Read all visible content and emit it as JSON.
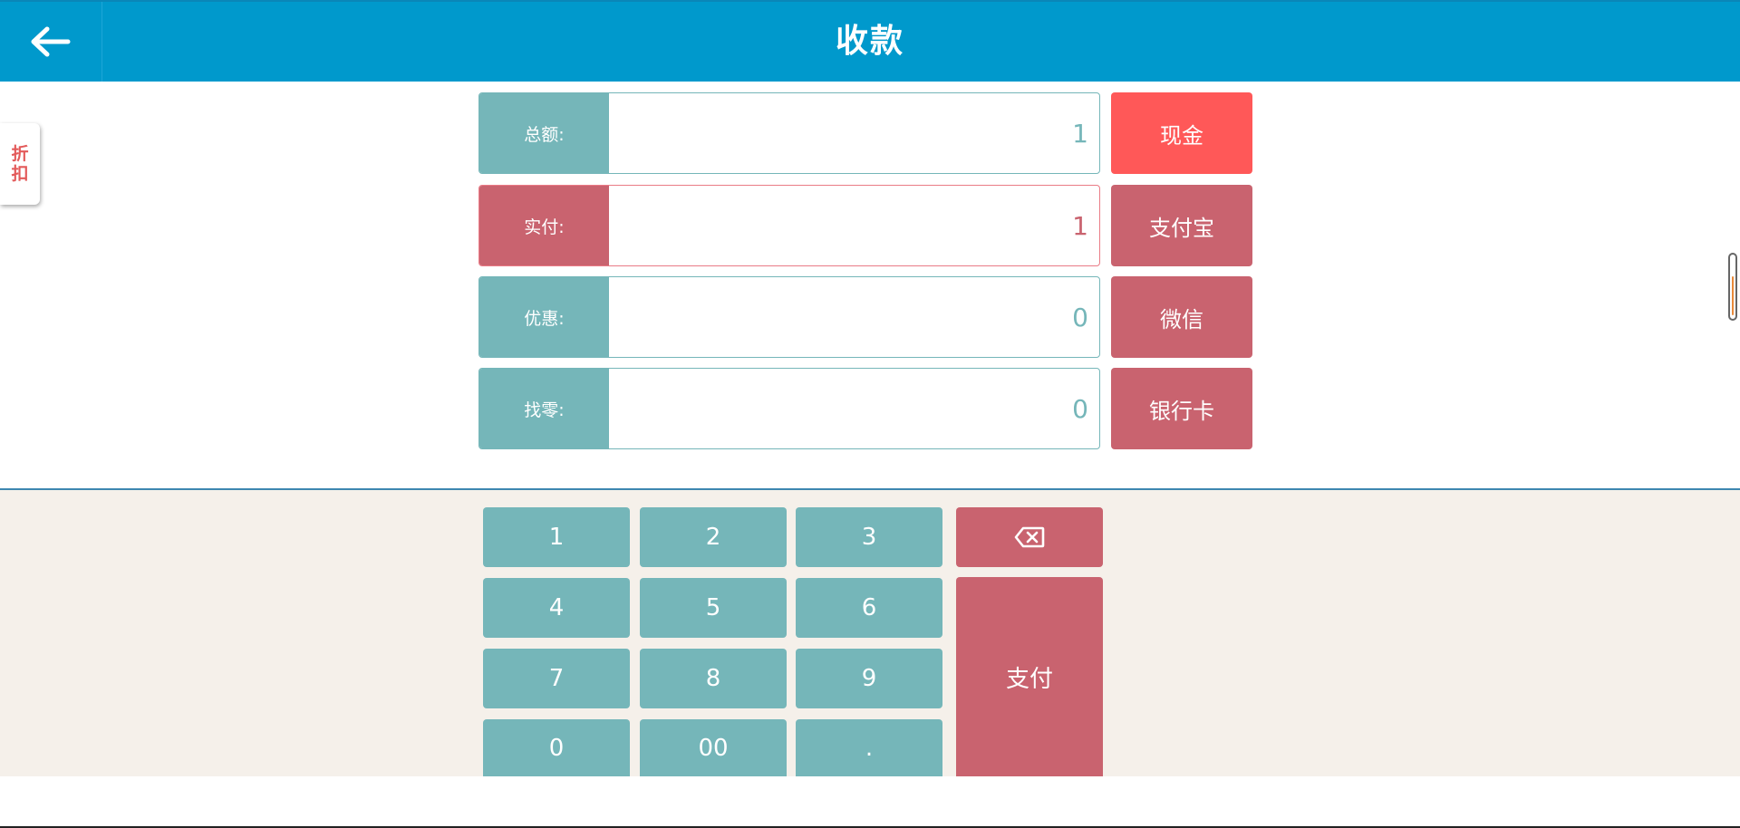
{
  "header": {
    "title": "收款",
    "back_icon": "arrow-left-icon"
  },
  "discount_tab": {
    "line1": "折",
    "line2": "扣"
  },
  "fields": [
    {
      "label": "总额:",
      "value": "1"
    },
    {
      "label": "实付:",
      "value": "1"
    },
    {
      "label": "优惠:",
      "value": "0"
    },
    {
      "label": "找零:",
      "value": "0"
    }
  ],
  "payment_methods": [
    "现金",
    "支付宝",
    "微信",
    "银行卡"
  ],
  "keypad": {
    "keys": [
      "1",
      "2",
      "3",
      "4",
      "5",
      "6",
      "7",
      "8",
      "9",
      "0",
      "00",
      "."
    ],
    "backspace_icon": "backspace-icon",
    "pay_label": "支付"
  },
  "colors": {
    "header_bg": "#0099cc",
    "teal": "#75b6b9",
    "rose": "#c9636f",
    "cash_red": "#ff5858",
    "keypad_bg": "#f5f0ea"
  }
}
